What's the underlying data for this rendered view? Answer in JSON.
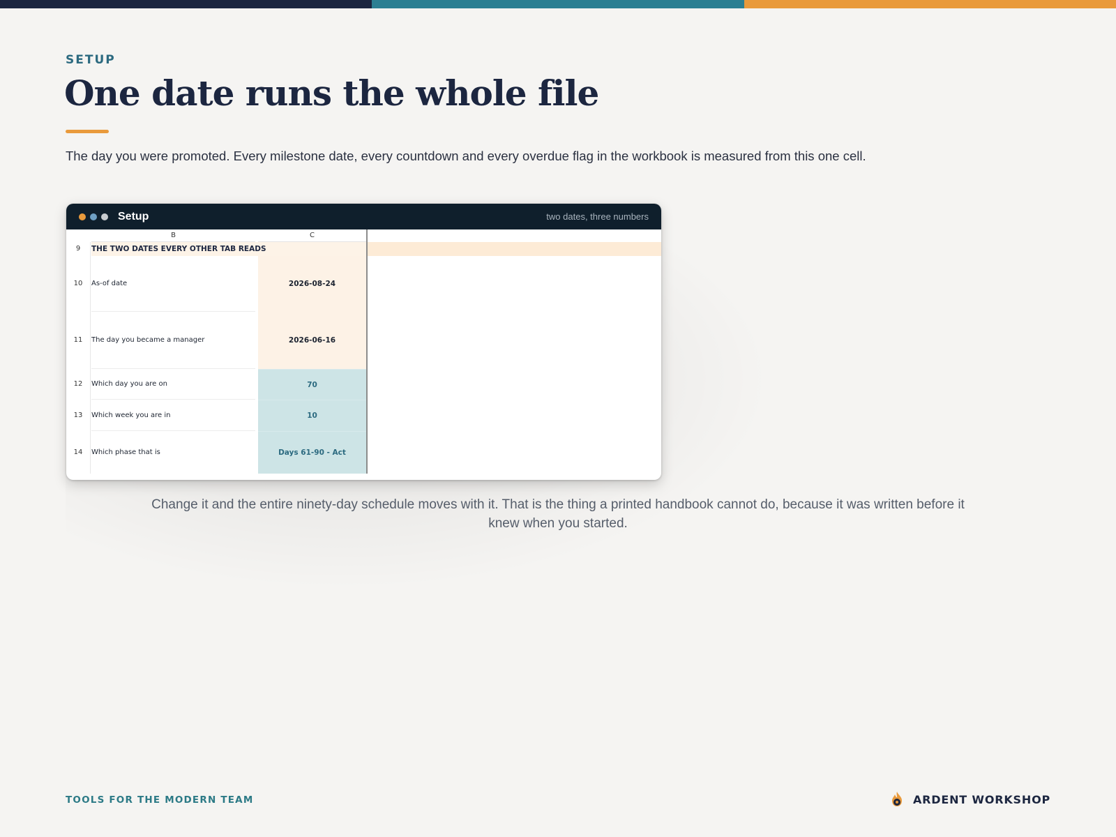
{
  "colors": {
    "navy": "#1c2640",
    "teal": "#2c7f92",
    "orange": "#e99a3c",
    "background": "#f5f4f2"
  },
  "header": {
    "eyebrow": "SETUP",
    "title": "One date runs the whole file",
    "lead": "The day you were promoted. Every milestone date, every countdown and every overdue flag in the workbook is measured from this one cell."
  },
  "window": {
    "title": "Setup",
    "subtitle": "two dates, three numbers",
    "dot_colors": [
      "#e99a3c",
      "#6fa0c4",
      "#c8ccd0"
    ]
  },
  "sheet": {
    "columns": [
      "B",
      "C"
    ],
    "section_row": {
      "row": "9",
      "label": "THE TWO DATES EVERY OTHER TAB READS"
    },
    "rows": [
      {
        "row": "10",
        "label": "As-of date",
        "value": "2026-08-24",
        "style": "tan"
      },
      {
        "row": "11",
        "label": "The day you became a manager",
        "value": "2026-06-16",
        "style": "tan"
      },
      {
        "row": "12",
        "label": "Which day you are on",
        "value": "70",
        "style": "teal"
      },
      {
        "row": "13",
        "label": "Which week you are in",
        "value": "10",
        "style": "teal"
      },
      {
        "row": "14",
        "label": "Which phase that is",
        "value": "Days 61-90 - Act",
        "style": "teal"
      }
    ]
  },
  "caption": "Change it and the entire ninety-day schedule moves with it. That is the thing a printed handbook cannot do, because it was written before it knew when you started.",
  "footer": {
    "tagline": "TOOLS FOR THE MODERN TEAM",
    "brand": "ARDENT WORKSHOP",
    "brand_icon": "flame-gear-icon"
  }
}
